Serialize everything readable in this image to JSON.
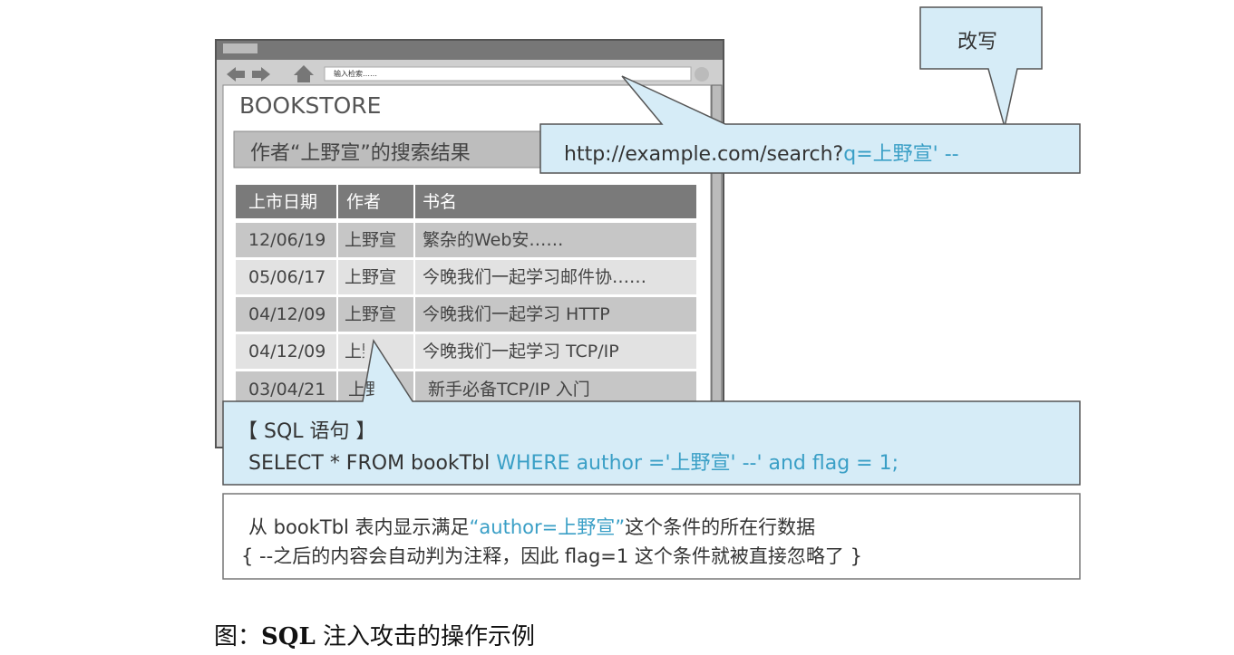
{
  "browser": {
    "address_placeholder": "输入检索……",
    "site_title": "BOOKSTORE",
    "result_heading": "作者“上野宣”的搜索结果"
  },
  "table": {
    "headers": [
      "上市日期",
      "作者",
      "书名"
    ],
    "rows": [
      [
        "12/06/19",
        "上野宣",
        "繁杂的Web安……"
      ],
      [
        "05/06/17",
        "上野宣",
        "今晚我们一起学习邮件协……"
      ],
      [
        "04/12/09",
        "上野宣",
        "今晚我们一起学习 HTTP"
      ],
      [
        "04/12/09",
        "上野宣",
        "今晚我们一起学习 TCP/IP"
      ],
      [
        "03/04/21",
        "上野宣",
        "新手必备TCP/IP 入门"
      ]
    ]
  },
  "callouts": {
    "rewrite": "改写",
    "url_plain": "http://example.com/search?",
    "url_injected": "q=上野宣' --",
    "sql_title": "【 SQL 语句 】",
    "sql_plain": "SELECT * FROM bookTbl ",
    "sql_highlight": "WHERE author ='上野宣' --' and flag = 1;"
  },
  "explanation": {
    "line1_a": "从 bookTbl 表内显示满足",
    "line1_b": "“author=上野宣”",
    "line1_c": "这个条件的所在行数据",
    "line2": "{ --之后的内容会自动判为注释，因此 flag=1 这个条件就被直接忽略了 }"
  },
  "caption": {
    "prefix": "图：",
    "bold": "SQL",
    "rest": " 注入攻击的操作示例"
  },
  "colors": {
    "callout_fill": "#d6ecf7",
    "highlight": "#3a9fc6",
    "title_bar": "#777777"
  }
}
